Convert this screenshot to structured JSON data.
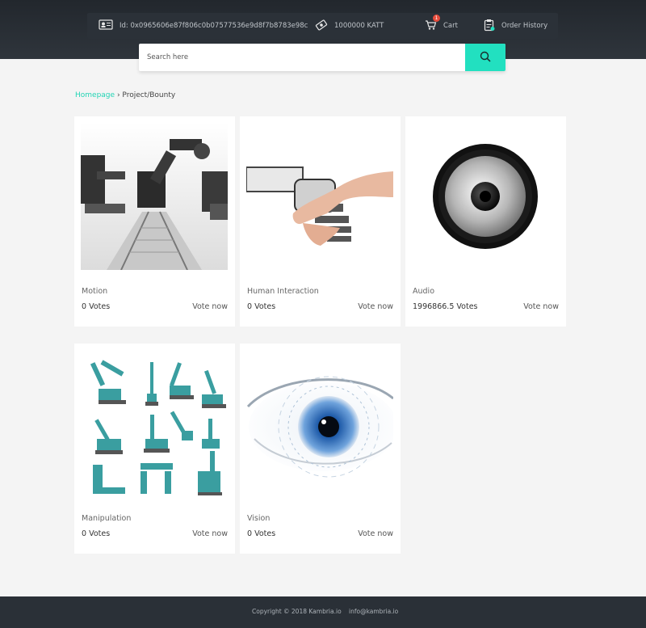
{
  "header": {
    "account_id": "Id: 0x0965606e87f806c0b07577536e9d8f7b8783e98c",
    "balance": "1000000 KATT",
    "cart_label": "Cart",
    "cart_count": "1",
    "order_history_label": "Order History"
  },
  "search": {
    "placeholder": "Search here"
  },
  "breadcrumb": {
    "home": "Homepage",
    "separator": "›",
    "current": "Project/Bounty"
  },
  "cards": [
    {
      "title": "Motion",
      "votes": "0 Votes",
      "action": "Vote now"
    },
    {
      "title": "Human Interaction",
      "votes": "0 Votes",
      "action": "Vote now"
    },
    {
      "title": "Audio",
      "votes": "1996866.5 Votes",
      "action": "Vote now"
    },
    {
      "title": "Manipulation",
      "votes": "0 Votes",
      "action": "Vote now"
    },
    {
      "title": "Vision",
      "votes": "0 Votes",
      "action": "Vote now"
    }
  ],
  "footer": {
    "copyright": "Copyright © 2018 Kambria.io",
    "email": "info@kambria.io"
  },
  "colors": {
    "accent": "#22e0c0",
    "header_bg": "#2a3037",
    "badge": "#e74c3c"
  },
  "icons": {
    "id": "id-card-icon",
    "balance": "token-icon",
    "cart": "cart-icon",
    "orders": "clipboard-icon",
    "search": "search-icon"
  }
}
